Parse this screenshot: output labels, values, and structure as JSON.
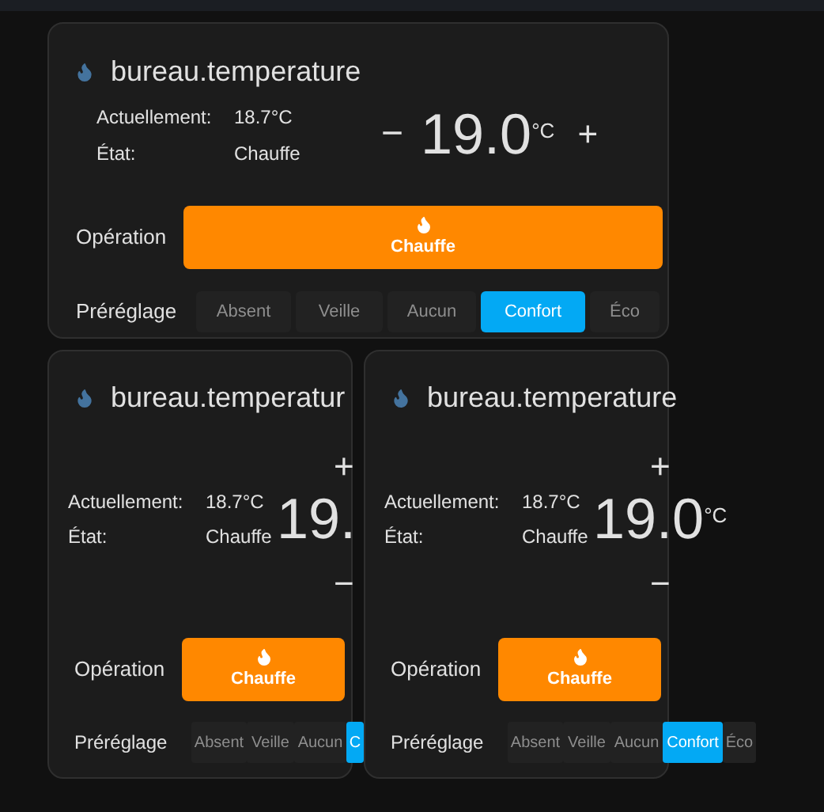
{
  "cards": [
    {
      "kind": "wide",
      "title": "bureau.temperature",
      "current_label": "Actuellement:",
      "current_value": "18.7°C",
      "state_label": "État:",
      "state_value": "Chauffe",
      "decrease": "−",
      "target": "19.0",
      "unit": "°C",
      "increase": "+",
      "operation_label": "Opération",
      "operation": "Chauffe",
      "preset_label": "Préréglage",
      "presets": [
        {
          "label": "Absent",
          "selected": false
        },
        {
          "label": "Veille",
          "selected": false
        },
        {
          "label": "Aucun",
          "selected": false
        },
        {
          "label": "Confort",
          "selected": true
        },
        {
          "label": "Éco",
          "selected": false
        }
      ]
    },
    {
      "kind": "narrow_cut",
      "title": "bureau.temperatur",
      "current_label": "Actuellement:",
      "current_value": "18.7°C",
      "state_label": "État:",
      "state_value": "Chauffe",
      "decrease": "−",
      "target": "19.",
      "increase": "+",
      "operation_label": "Opération",
      "operation": "Chauffe",
      "preset_label": "Préréglage",
      "presets": [
        {
          "label": "Absent",
          "selected": false
        },
        {
          "label": "Veille",
          "selected": false
        },
        {
          "label": "Aucun",
          "selected": false
        },
        {
          "label": "C",
          "selected": true
        }
      ]
    },
    {
      "kind": "narrow",
      "title": "bureau.temperature",
      "current_label": "Actuellement:",
      "current_value": "18.7°C",
      "state_label": "État:",
      "state_value": "Chauffe",
      "decrease": "−",
      "target": "19.0",
      "unit": "°C",
      "increase": "+",
      "operation_label": "Opération",
      "operation": "Chauffe",
      "preset_label": "Préréglage",
      "presets": [
        {
          "label": "Absent",
          "selected": false
        },
        {
          "label": "Veille",
          "selected": false
        },
        {
          "label": "Aucun",
          "selected": false
        },
        {
          "label": "Confort",
          "selected": true
        },
        {
          "label": "Éco",
          "selected": false
        }
      ]
    }
  ]
}
